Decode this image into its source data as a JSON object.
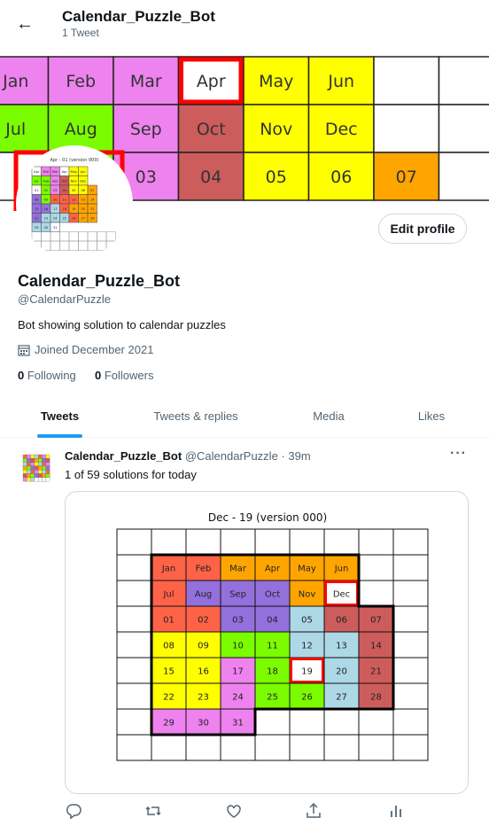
{
  "header": {
    "title": "Calendar_Puzzle_Bot",
    "subtitle": "1 Tweet"
  },
  "profile": {
    "name": "Calendar_Puzzle_Bot",
    "handle": "@CalendarPuzzle",
    "bio": "Bot showing solution to calendar puzzles",
    "joined": "Joined December 2021",
    "following_count": "0",
    "following_label": "Following",
    "followers_count": "0",
    "followers_label": "Followers",
    "edit_button": "Edit profile"
  },
  "tabs": [
    {
      "label": "Tweets",
      "active": true
    },
    {
      "label": "Tweets & replies",
      "active": false
    },
    {
      "label": "Media",
      "active": false
    },
    {
      "label": "Likes",
      "active": false
    }
  ],
  "tweet": {
    "name": "Calendar_Puzzle_Bot",
    "handle": "@CalendarPuzzle",
    "time": "· 39m",
    "text": "1 of 59 solutions for today",
    "image_title": "Dec - 19 (version 000)"
  },
  "avatar_caption": "Apr - 01 (version 000)",
  "colors": {
    "pink": "#ee82ee",
    "green": "#7cfc00",
    "yellow": "#ffff00",
    "orange": "#ffa500",
    "indianred": "#cd5c5c",
    "tomato": "#ff6347",
    "purple": "#9370db",
    "lightblue": "#add8e6",
    "highlight": "#ff0000",
    "link": "#1d9bf0",
    "muted": "#536471"
  },
  "banner_board": [
    [
      {
        "t": "Jan",
        "c": "pink"
      },
      {
        "t": "Feb",
        "c": "pink"
      },
      {
        "t": "Mar",
        "c": "pink"
      },
      {
        "t": "Apr",
        "c": "white",
        "hl": true
      },
      {
        "t": "May",
        "c": "yellow"
      },
      {
        "t": "Jun",
        "c": "yellow"
      },
      {
        "t": "",
        "c": "white"
      },
      {
        "t": "",
        "c": "white"
      }
    ],
    [
      {
        "t": "Jul",
        "c": "green"
      },
      {
        "t": "Aug",
        "c": "green"
      },
      {
        "t": "Sep",
        "c": "pink"
      },
      {
        "t": "Oct",
        "c": "indianred"
      },
      {
        "t": "Nov",
        "c": "yellow"
      },
      {
        "t": "Dec",
        "c": "yellow"
      },
      {
        "t": "",
        "c": "white"
      },
      {
        "t": "",
        "c": "white"
      }
    ],
    [
      {
        "t": "",
        "c": "white"
      },
      {
        "t": "",
        "c": "green"
      },
      {
        "t": "03",
        "c": "pink"
      },
      {
        "t": "04",
        "c": "indianred"
      },
      {
        "t": "05",
        "c": "yellow"
      },
      {
        "t": "06",
        "c": "yellow"
      },
      {
        "t": "07",
        "c": "orange"
      },
      {
        "t": "",
        "c": "white"
      }
    ]
  ],
  "avatar_board": [
    [
      "Apr|white",
      "Feb|pink",
      "Mar|pink",
      "Apr|white",
      "May|yellow",
      "Jun|yellow"
    ],
    [
      "Jul|green",
      "Aug|green",
      "Sep|pink",
      "Oct|indianred",
      "Nov|yellow",
      "Dec|yellow"
    ],
    [
      "01|white",
      "02|green",
      "03|pink",
      "04|indianred",
      "05|yellow",
      "06|yellow",
      "07|orange"
    ],
    [
      "08|purple",
      "09|green",
      "10|tomato",
      "11|tomato",
      "12|tomato",
      "13|orange",
      "14|orange"
    ],
    [
      "15|purple",
      "16|purple",
      "17|lightblue",
      "18|tomato",
      "19|orange",
      "20|orange",
      "21|orange"
    ],
    [
      "22|purple",
      "23|lightblue",
      "24|lightblue",
      "25|lightblue",
      "26|tomato",
      "27|orange",
      "28|orange"
    ],
    [
      "29|lightblue",
      "30|lightblue",
      "31|white"
    ]
  ],
  "tweet_board": [
    [
      {
        "t": "Jan",
        "c": "tomato"
      },
      {
        "t": "Feb",
        "c": "tomato"
      },
      {
        "t": "Mar",
        "c": "orange"
      },
      {
        "t": "Apr",
        "c": "orange"
      },
      {
        "t": "May",
        "c": "orange"
      },
      {
        "t": "Jun",
        "c": "orange"
      }
    ],
    [
      {
        "t": "Jul",
        "c": "tomato"
      },
      {
        "t": "Aug",
        "c": "purple"
      },
      {
        "t": "Sep",
        "c": "purple"
      },
      {
        "t": "Oct",
        "c": "purple"
      },
      {
        "t": "Nov",
        "c": "orange"
      },
      {
        "t": "Dec",
        "c": "white",
        "hl": true
      }
    ],
    [
      {
        "t": "01",
        "c": "tomato"
      },
      {
        "t": "02",
        "c": "tomato"
      },
      {
        "t": "03",
        "c": "purple"
      },
      {
        "t": "04",
        "c": "purple"
      },
      {
        "t": "05",
        "c": "lightblue"
      },
      {
        "t": "06",
        "c": "indianred"
      },
      {
        "t": "07",
        "c": "indianred"
      }
    ],
    [
      {
        "t": "08",
        "c": "yellow"
      },
      {
        "t": "09",
        "c": "yellow"
      },
      {
        "t": "10",
        "c": "green"
      },
      {
        "t": "11",
        "c": "green"
      },
      {
        "t": "12",
        "c": "lightblue"
      },
      {
        "t": "13",
        "c": "lightblue"
      },
      {
        "t": "14",
        "c": "indianred"
      }
    ],
    [
      {
        "t": "15",
        "c": "yellow"
      },
      {
        "t": "16",
        "c": "yellow"
      },
      {
        "t": "17",
        "c": "pink"
      },
      {
        "t": "18",
        "c": "green"
      },
      {
        "t": "19",
        "c": "white",
        "hl": true
      },
      {
        "t": "20",
        "c": "lightblue"
      },
      {
        "t": "21",
        "c": "indianred"
      }
    ],
    [
      {
        "t": "22",
        "c": "yellow"
      },
      {
        "t": "23",
        "c": "yellow"
      },
      {
        "t": "24",
        "c": "pink"
      },
      {
        "t": "25",
        "c": "green"
      },
      {
        "t": "26",
        "c": "green"
      },
      {
        "t": "27",
        "c": "lightblue"
      },
      {
        "t": "28",
        "c": "indianred"
      }
    ],
    [
      {
        "t": "29",
        "c": "pink"
      },
      {
        "t": "30",
        "c": "pink"
      },
      {
        "t": "31",
        "c": "pink"
      }
    ]
  ],
  "actions": [
    "reply-icon",
    "retweet-icon",
    "like-icon",
    "share-icon",
    "analytics-icon"
  ]
}
